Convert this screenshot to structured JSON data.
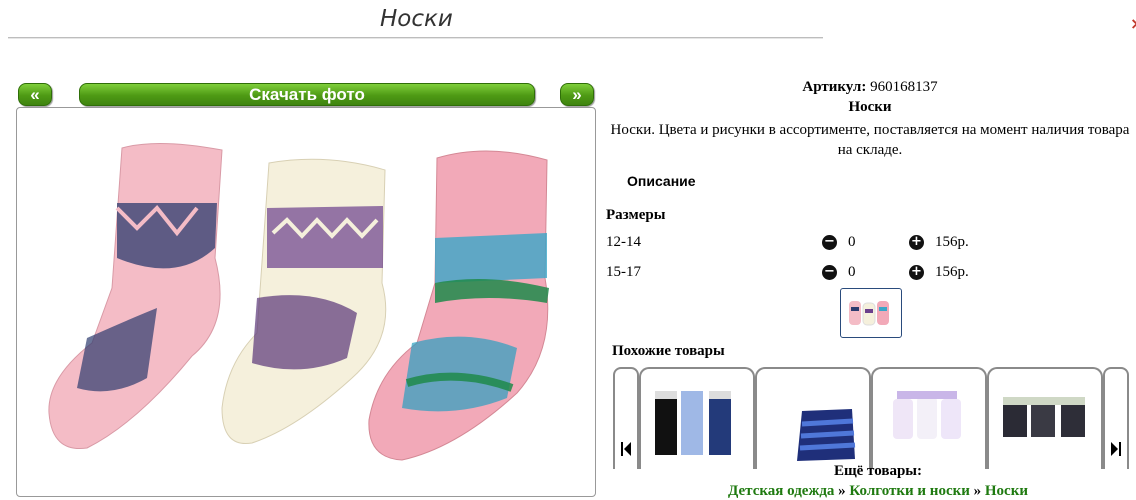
{
  "page": {
    "title": "Носки",
    "close_mark": "×"
  },
  "gallery": {
    "prev_label": "«",
    "download_label": "Скачать фото",
    "next_label": "»",
    "colors": {
      "button_green": "#5aa71c",
      "sock_pink": "#f2b8c2",
      "sock_cream": "#f4efd9"
    }
  },
  "product": {
    "article_label": "Артикул:",
    "article_value": "960168137",
    "name": "Носки",
    "description": "Носки. Цвета и рисунки в ассортименте, поставляется на момент наличия товара на складе.",
    "desc_tab": "Описание"
  },
  "sizes": {
    "title": "Размеры",
    "rows": [
      {
        "size": "12-14",
        "qty": "0",
        "price": "156р."
      },
      {
        "size": "15-17",
        "qty": "0",
        "price": "156р."
      }
    ],
    "minus_icon": "minus-circle-icon",
    "plus_icon": "plus-circle-icon"
  },
  "similar": {
    "title": "Похожие товары"
  },
  "more": {
    "title": "Ещё товары:",
    "crumbs": [
      "Детская одежда",
      "Колготки и носки",
      "Носки"
    ],
    "separator": "»"
  }
}
